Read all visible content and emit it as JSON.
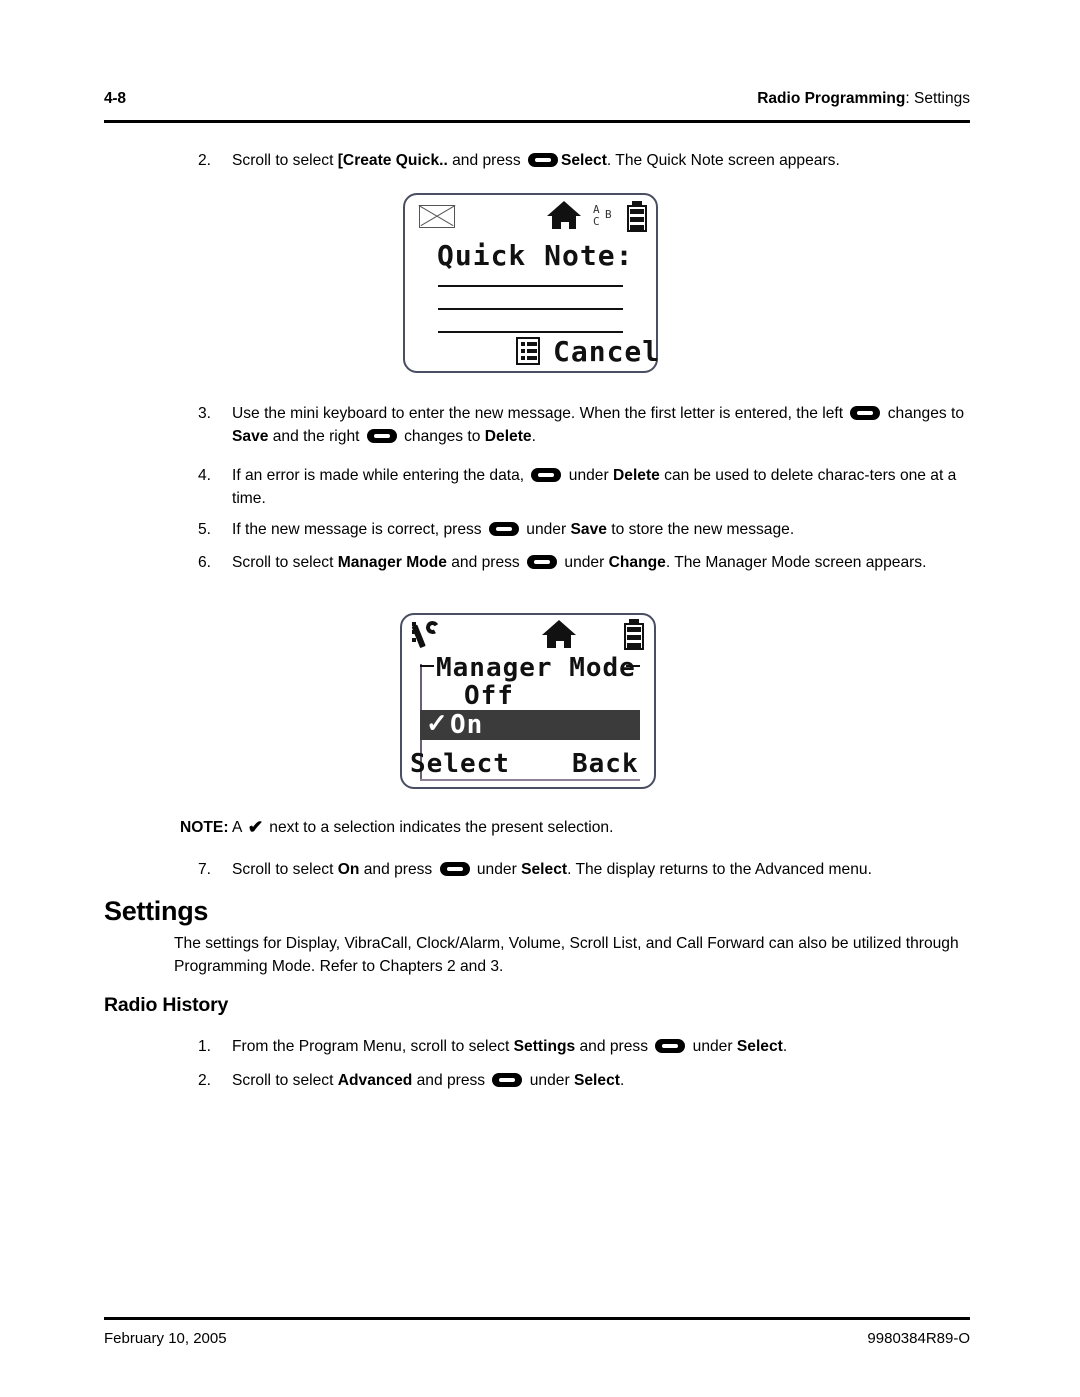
{
  "header": {
    "page_number": "4-8",
    "chapter_bold": "Radio Programming",
    "chapter_rest": ": Settings"
  },
  "footer": {
    "date": "February 10, 2005",
    "doc_id": "9980384R89-O"
  },
  "steps": {
    "s2": {
      "num": "2.",
      "p1": "Scroll to select ",
      "b1": "[Create Quick..",
      "p2": " and press ",
      "b2": "Select",
      "p3": ". The Quick Note screen appears."
    },
    "s3": {
      "num": "3.",
      "p1": "Use the mini keyboard to enter the new message. When the first letter is entered, the left ",
      "p2": " changes to ",
      "b1": "Save",
      "p3": " and the right ",
      "p4": " changes to ",
      "b2": "Delete",
      "p5": "."
    },
    "s4": {
      "num": "4.",
      "p1": "If an error is made while entering the data, ",
      "p2": " under ",
      "b1": "Delete",
      "p3": " can be used to delete charac-ters one at a time."
    },
    "s5": {
      "num": "5.",
      "p1": "If the new message is correct, press ",
      "p2": " under ",
      "b1": "Save",
      "p3": " to store the new message."
    },
    "s6": {
      "num": "6.",
      "p1": "Scroll to select ",
      "b1": "Manager Mode",
      "p2": " and press ",
      "p3": " under ",
      "b2": "Change",
      "p4": ". The Manager Mode screen appears."
    },
    "s7": {
      "num": "7.",
      "p1": "Scroll to select ",
      "b1": "On",
      "p2": " and press ",
      "p3": " under ",
      "b2": "Select",
      "p4": ". The display returns to the Advanced menu."
    },
    "rh1": {
      "num": "1.",
      "p1": "From the Program Menu, scroll to select ",
      "b1": "Settings",
      "p2": " and press ",
      "p3": " under ",
      "b2": "Select",
      "p4": "."
    },
    "rh2": {
      "num": "2.",
      "p1": "Scroll to select ",
      "b1": "Advanced",
      "p2": " and press ",
      "p3": " under ",
      "b2": "Select",
      "p4": "."
    }
  },
  "note": {
    "label": "NOTE:",
    "p1": " A ",
    "check": "✔",
    "p2": " next to a selection indicates the present selection."
  },
  "headings": {
    "settings": "Settings",
    "radio_history": "Radio History"
  },
  "settings_para": "The settings for Display, VibraCall, Clock/Alarm, Volume, Scroll List, and Call Forward can also be utilized through Programming Mode. Refer to Chapters 2 and 3.",
  "lcd_quick_note": {
    "icons": {
      "envelope": "envelope-icon",
      "house": "home-icon",
      "abc_a": "A",
      "abc_b": "B",
      "abc_c": "C",
      "battery": "battery-icon",
      "list": "menu-list-icon"
    },
    "title": "Quick Note:",
    "softkey_right": "Cancel",
    "entry_lines": 3
  },
  "lcd_manager_mode": {
    "icons": {
      "wrench": "wrench-icon",
      "house": "home-icon",
      "battery": "battery-icon"
    },
    "title": "Manager Mode",
    "option_off": "Off",
    "option_on": "On",
    "selected_check": "✓",
    "softkey_left": "Select",
    "softkey_right": "Back",
    "highlight_color": "#3b3b3b"
  }
}
